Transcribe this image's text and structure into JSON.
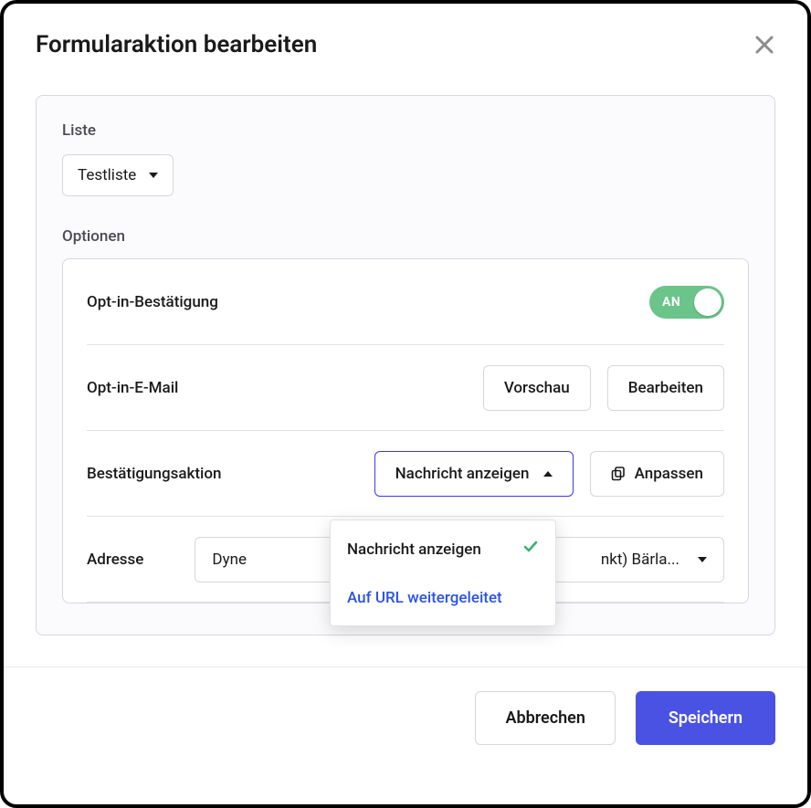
{
  "dialog": {
    "title": "Formularaktion bearbeiten"
  },
  "list": {
    "label": "Liste",
    "selected": "Testliste"
  },
  "options": {
    "label": "Optionen",
    "optin_confirm": {
      "label": "Opt-in-Bestätigung",
      "toggle_text": "AN",
      "on": true
    },
    "optin_email": {
      "label": "Opt-in-E-Mail",
      "preview": "Vorschau",
      "edit": "Bearbeiten"
    },
    "confirm_action": {
      "label": "Bestätigungsaktion",
      "selected": "Nachricht anzeigen",
      "customize": "Anpassen",
      "menu": {
        "show_message": "Nachricht anzeigen",
        "redirect_url": "Auf URL weitergeleitet"
      }
    },
    "address": {
      "label": "Adresse",
      "value_prefix": "Dyne",
      "value_suffix": "nkt) Bärla..."
    }
  },
  "footer": {
    "cancel": "Abbrechen",
    "save": "Speichern"
  }
}
